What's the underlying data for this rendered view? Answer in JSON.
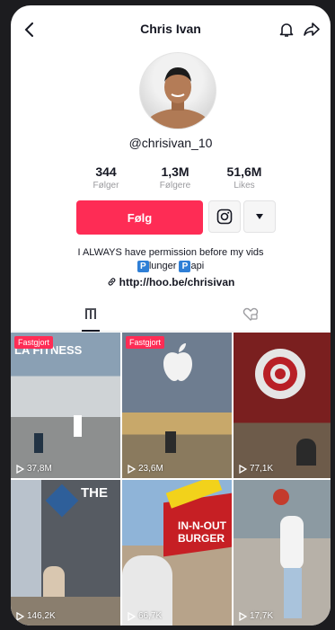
{
  "header": {
    "title": "Chris Ivan"
  },
  "profile": {
    "username": "@chrisivan_10"
  },
  "stats": [
    {
      "value": "344",
      "label": "Følger"
    },
    {
      "value": "1,3M",
      "label": "Følgere"
    },
    {
      "value": "51,6M",
      "label": "Likes"
    }
  ],
  "actions": {
    "follow_label": "Følg"
  },
  "bio": {
    "line1": "I ALWAYS have permission before my vids",
    "line2_a": "P",
    "line2_b": "lunger ",
    "line2_c": "P",
    "line2_d": "api"
  },
  "link": {
    "text": "http://hoo.be/chrisivan"
  },
  "videos": [
    {
      "pinned": "Fastgjort",
      "views": "37,8M",
      "overlay": "LA FITNESS"
    },
    {
      "pinned": "Fastgjort",
      "views": "23,6M",
      "overlay": ""
    },
    {
      "pinned": "",
      "views": "77,1K",
      "overlay": ""
    },
    {
      "pinned": "",
      "views": "146,2K",
      "overlay": "THE"
    },
    {
      "pinned": "",
      "views": "66,7K",
      "overlay": "IN-N-OUT BURGER"
    },
    {
      "pinned": "",
      "views": "17,7K",
      "overlay": ""
    }
  ],
  "colors": {
    "accent": "#fe2c55",
    "badge": "#2f7fd6"
  }
}
